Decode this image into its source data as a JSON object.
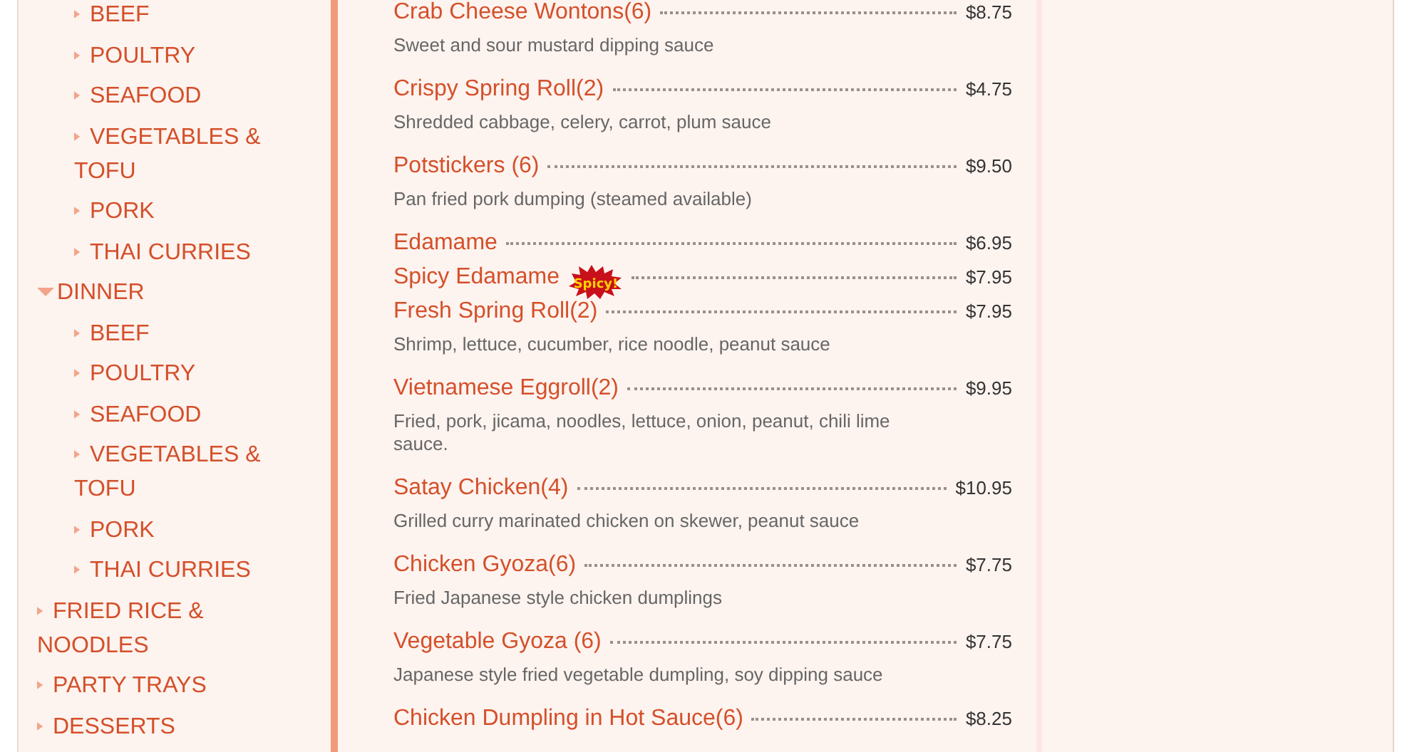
{
  "sidebar": {
    "items": [
      {
        "children": [
          {
            "label": "BEEF",
            "expanded": false
          },
          {
            "label": "POULTRY",
            "expanded": false
          },
          {
            "label": "SEAFOOD",
            "expanded": false
          },
          {
            "label": "VEGETABLES & TOFU",
            "expanded": false
          },
          {
            "label": "PORK",
            "expanded": false
          },
          {
            "label": "THAI CURRIES",
            "expanded": false
          }
        ]
      },
      {
        "label": "DINNER",
        "expanded": true,
        "children": [
          {
            "label": "BEEF",
            "expanded": false
          },
          {
            "label": "POULTRY",
            "expanded": false
          },
          {
            "label": "SEAFOOD",
            "expanded": false
          },
          {
            "label": "VEGETABLES & TOFU",
            "expanded": false
          },
          {
            "label": "PORK",
            "expanded": false
          },
          {
            "label": "THAI CURRIES",
            "expanded": false
          }
        ]
      },
      {
        "label": "FRIED RICE & NOODLES",
        "expanded": false
      },
      {
        "label": "PARTY TRAYS",
        "expanded": false
      },
      {
        "label": "DESSERTS",
        "expanded": false
      }
    ]
  },
  "menu_items": [
    {
      "name": "Crab Cheese Wontons(6)",
      "price": "$8.75",
      "description": "Sweet and sour mustard dipping sauce"
    },
    {
      "name": "Crispy Spring Roll(2)",
      "price": "$4.75",
      "description": "Shredded cabbage, celery, carrot, plum sauce"
    },
    {
      "name": "Potstickers (6)",
      "price": "$9.50",
      "description": "Pan fried pork dumping (steamed available)"
    },
    {
      "name": "Edamame",
      "price": "$6.95"
    },
    {
      "name": "Spicy Edamame",
      "price": "$7.95",
      "badge": "Spicy!"
    },
    {
      "name": "Fresh Spring Roll(2)",
      "price": "$7.95",
      "description": "Shrimp, lettuce, cucumber, rice noodle, peanut sauce"
    },
    {
      "name": "Vietnamese Eggroll(2)",
      "price": "$9.95",
      "description": "Fried, pork, jicama, noodles, lettuce, onion, peanut, chili lime sauce."
    },
    {
      "name": "Satay Chicken(4)",
      "price": "$10.95",
      "description": "Grilled curry marinated chicken on skewer, peanut sauce"
    },
    {
      "name": "Chicken Gyoza(6)",
      "price": "$7.75",
      "description": "Fried Japanese style chicken dumplings"
    },
    {
      "name": "Vegetable Gyoza (6)",
      "price": "$7.75",
      "description": "Japanese style fried vegetable dumpling, soy dipping sauce"
    },
    {
      "name": "Chicken Dumpling in Hot Sauce(6)",
      "price": "$8.25"
    }
  ]
}
